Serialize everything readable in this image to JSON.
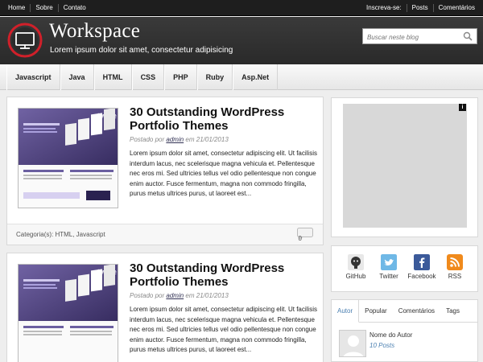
{
  "topbar": {
    "left_links": [
      "Home",
      "Sobre",
      "Contato"
    ],
    "subscribe_label": "Inscreva-se:",
    "right_links": [
      "Posts",
      "Comentários"
    ]
  },
  "header": {
    "site_title": "Workspace",
    "site_description": "Lorem ipsum dolor sit amet, consectetur adipisicing",
    "search_placeholder": "Buscar neste blog"
  },
  "nav": {
    "items": [
      "Javascript",
      "Java",
      "HTML",
      "CSS",
      "PHP",
      "Ruby",
      "Asp.Net"
    ]
  },
  "posts": [
    {
      "title": "30 Outstanding WordPress Portfolio Themes",
      "meta_prefix": "Postado por",
      "author": "admin",
      "meta_date": "em 21/01/2013",
      "excerpt": "Lorem ipsum dolor sit amet, consectetur adipiscing elit. Ut facilisis interdum lacus, nec scelerisque magna vehicula et. Pellentesque nec eros mi. Sed ultricies tellus vel odio pellentesque non congue enim auctor. Fusce fermentum, magna non commodo fringilla, purus metus ultrices purus, ut laoreet est...",
      "categories": "Categoria(s): HTML, Javascript",
      "comment_count": "0",
      "thumb_brand": "twice"
    },
    {
      "title": "30 Outstanding WordPress Portfolio Themes",
      "meta_prefix": "Postado por",
      "author": "admin",
      "meta_date": "em 21/01/2013",
      "excerpt": "Lorem ipsum dolor sit amet, consectetur adipiscing elit. Ut facilisis interdum lacus, nec scelerisque magna vehicula et. Pellentesque nec eros mi. Sed ultricies tellus vel odio pellentesque non congue enim auctor. Fusce fermentum, magna non commodo fringilla, purus metus ultrices purus, ut laoreet est...",
      "thumb_brand": "twice"
    }
  ],
  "sidebar": {
    "ad_info": "i",
    "social": [
      {
        "label": "GitHub",
        "icon": "github-icon",
        "color": "#333333"
      },
      {
        "label": "Twitter",
        "icon": "twitter-icon",
        "color": "#4fa3d9"
      },
      {
        "label": "Facebook",
        "icon": "facebook-icon",
        "color": "#3b5a9a"
      },
      {
        "label": "RSS",
        "icon": "rss-icon",
        "color": "#f08a1c"
      }
    ],
    "tabs": [
      "Autor",
      "Popular",
      "Comentários",
      "Tags"
    ],
    "author": {
      "name": "Nome do Autor",
      "posts": "10 Posts"
    }
  },
  "colors": {
    "accent_link": "#4a7fb0",
    "logo_red": "#d0202a",
    "header_bg": "#2f2f2f"
  }
}
